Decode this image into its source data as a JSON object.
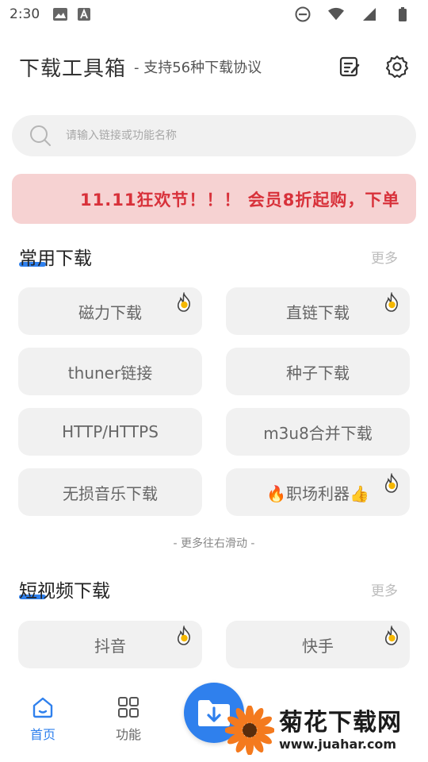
{
  "status_bar": {
    "time": "2:30"
  },
  "header": {
    "title": "下载工具箱",
    "subtitle": "- 支持56种下载协议"
  },
  "search": {
    "placeholder": "请输入链接或功能名称"
  },
  "banner": {
    "text": "11.11狂欢节！！！ 会员8折起购，下单"
  },
  "sections": [
    {
      "title": "常用下载",
      "more": "更多",
      "items": [
        {
          "label": "磁力下载",
          "hot": true
        },
        {
          "label": "直链下载",
          "hot": true
        },
        {
          "label": "thuner链接",
          "hot": false
        },
        {
          "label": "种子下载",
          "hot": false
        },
        {
          "label": "HTTP/HTTPS",
          "hot": false
        },
        {
          "label": "m3u8合并下载",
          "hot": false
        },
        {
          "label": "无损音乐下载",
          "hot": false
        },
        {
          "label": "🔥职场利器👍",
          "hot": true
        }
      ]
    },
    {
      "title": "短视频下载",
      "more": "更多",
      "items": [
        {
          "label": "抖音",
          "hot": true
        },
        {
          "label": "快手",
          "hot": true
        }
      ]
    }
  ],
  "scroll_hint": "- 更多往右滑动 -",
  "bottom_nav": {
    "items": [
      {
        "label": "首页",
        "icon": "home-icon",
        "active": true
      },
      {
        "label": "功能",
        "icon": "grid-icon",
        "active": false
      }
    ]
  },
  "watermark": {
    "cn": "菊花下载网",
    "url": "www.juahar.com"
  },
  "colors": {
    "accent": "#2f80ed",
    "banner_bg": "#f6d2d2",
    "banner_text": "#d8313a"
  }
}
